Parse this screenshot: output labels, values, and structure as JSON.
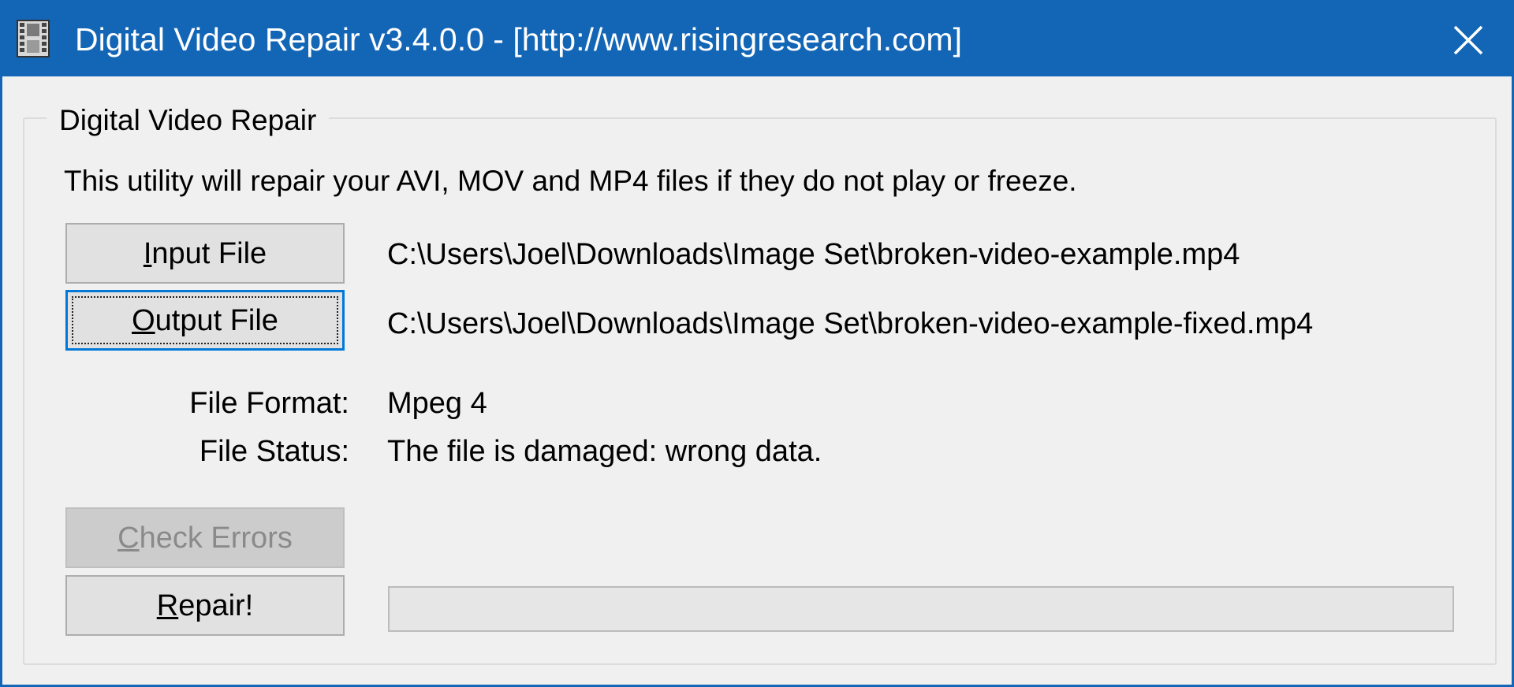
{
  "window": {
    "title": "Digital Video Repair v3.4.0.0 - [http://www.risingresearch.com]",
    "accent_color": "#1366b6",
    "icons": {
      "app": "film-strip-icon",
      "close": "close-icon"
    }
  },
  "group": {
    "legend": "Digital Video Repair",
    "description": "This utility will repair your AVI, MOV and MP4 files if they do not play or freeze."
  },
  "input_file": {
    "button_label_mnemonic": "I",
    "button_label_rest": "nput File",
    "path": "C:\\Users\\Joel\\Downloads\\Image Set\\broken-video-example.mp4"
  },
  "output_file": {
    "button_label_mnemonic": "O",
    "button_label_rest": "utput File",
    "path": "C:\\Users\\Joel\\Downloads\\Image Set\\broken-video-example-fixed.mp4"
  },
  "info": {
    "format_label": "File Format:",
    "format_value": "Mpeg 4",
    "status_label": "File Status:",
    "status_value": "The file is damaged: wrong data."
  },
  "actions": {
    "check_mnemonic": "C",
    "check_rest": "heck Errors",
    "check_enabled": false,
    "repair_mnemonic": "R",
    "repair_rest": "epair!"
  },
  "progress": {
    "value": 0
  }
}
